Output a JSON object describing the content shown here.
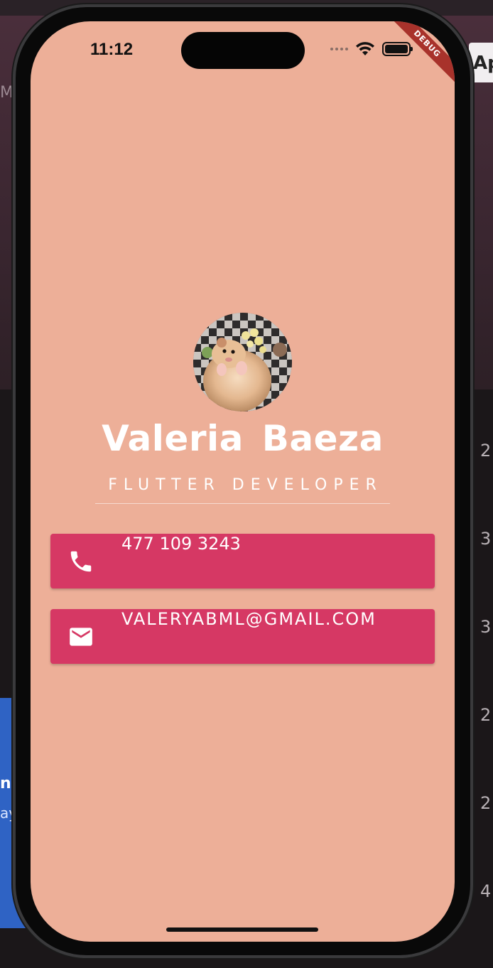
{
  "background": {
    "tab_label": "Ap",
    "side_letter": "M",
    "left_panel_line1": "n",
    "left_panel_line2": "ay",
    "right_numbers": [
      "2",
      "3",
      "3",
      "2",
      "2",
      "4"
    ]
  },
  "status_bar": {
    "time": "11:12"
  },
  "debug_banner": "DEBUG",
  "profile": {
    "name": "Valeria Baeza",
    "role": "FLUTTER DEVELOPER",
    "avatar_icon": "hamster-photo"
  },
  "contacts": {
    "phone": {
      "icon": "phone-icon",
      "value": "477 109 3243"
    },
    "email": {
      "icon": "mail-icon",
      "value": "VALERYABML@GMAIL.COM"
    }
  },
  "colors": {
    "screen_background": "#edaf98",
    "card_background": "#d63864",
    "text": "#ffffff",
    "debug_banner": "#a8322b"
  }
}
